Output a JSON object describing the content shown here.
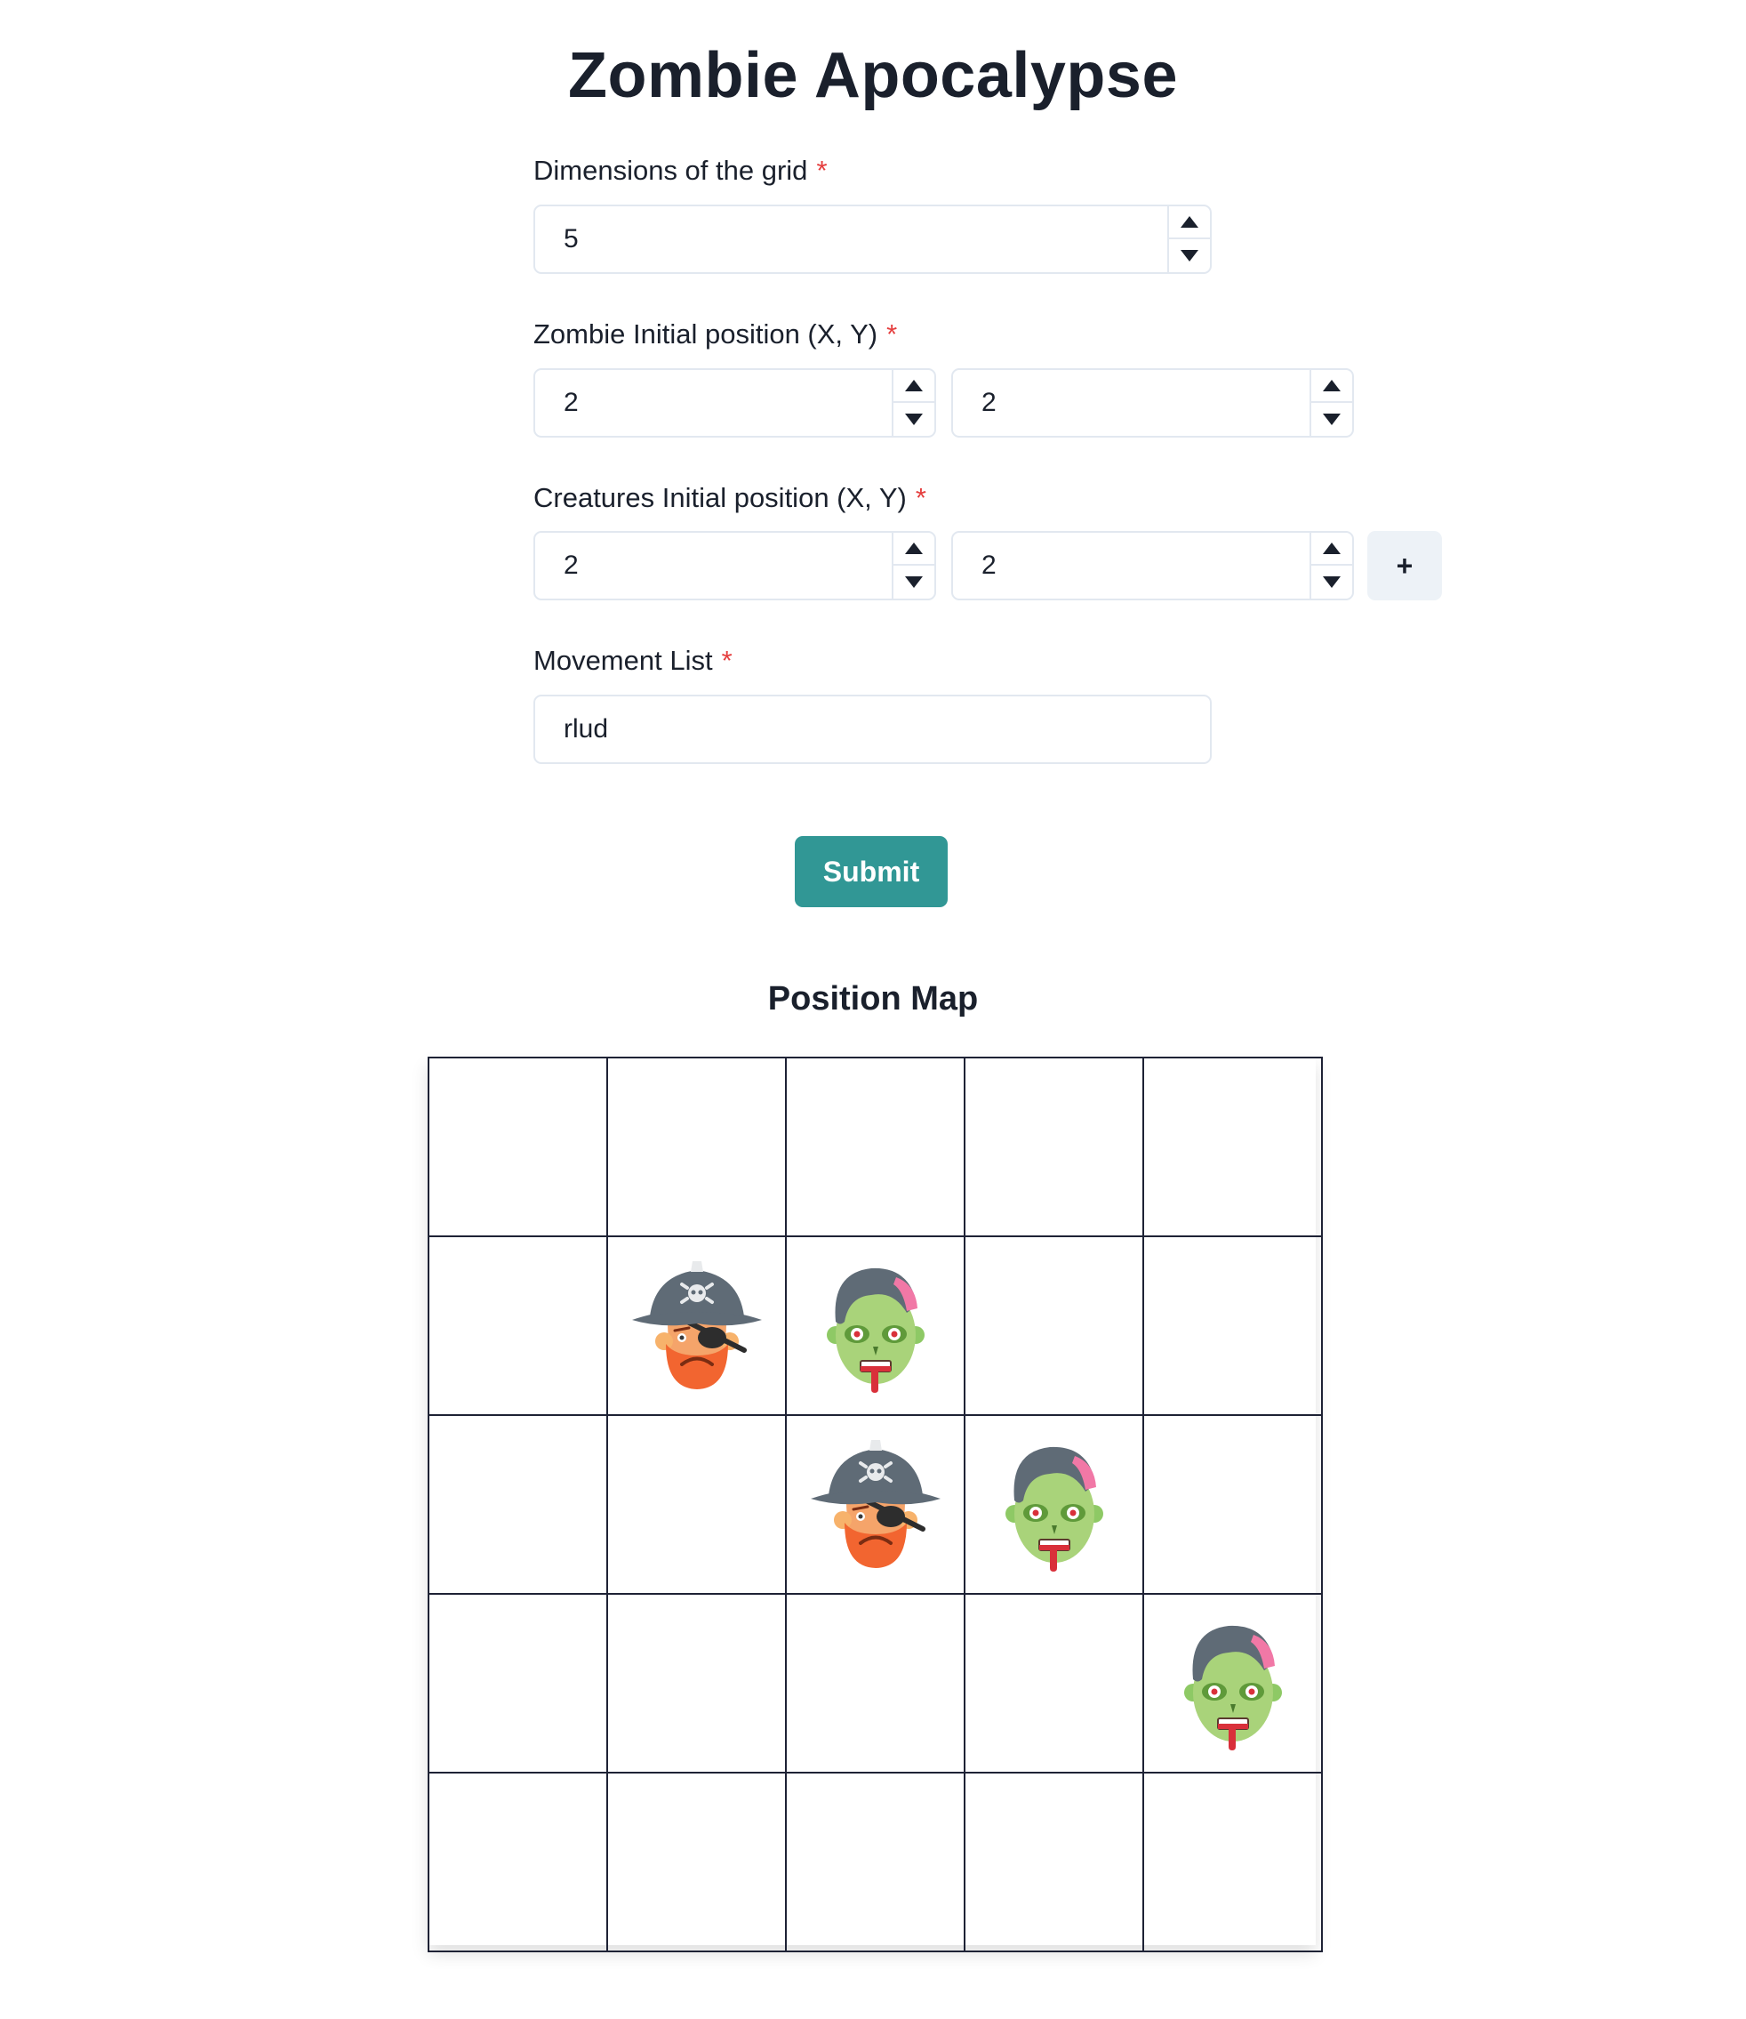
{
  "title": "Zombie Apocalypse",
  "dimensions": {
    "label": "Dimensions of the grid",
    "required_mark": "*",
    "value": "5"
  },
  "zombie_position": {
    "label": "Zombie Initial position (X, Y)",
    "required_mark": "*",
    "x": "2",
    "y": "2"
  },
  "creatures_position": {
    "label": "Creatures Initial position (X, Y)",
    "required_mark": "*",
    "x": "2",
    "y": "2",
    "add_label": "+"
  },
  "movement": {
    "label": "Movement List",
    "required_mark": "*",
    "value": "rlud"
  },
  "submit_label": "Submit",
  "map": {
    "title": "Position Map",
    "size": 5,
    "cells": [
      [
        "",
        "",
        "",
        "",
        ""
      ],
      [
        "",
        "pirate",
        "zombie",
        "",
        ""
      ],
      [
        "",
        "",
        "pirate",
        "zombie",
        ""
      ],
      [
        "",
        "",
        "",
        "",
        "zombie"
      ],
      [
        "",
        "",
        "",
        "",
        ""
      ]
    ]
  },
  "colors": {
    "accent": "#319795",
    "required": "#e53e3e",
    "grid_line": "#1e2235",
    "input_border": "#e2e8f0",
    "secondary_button": "#edf2f7"
  },
  "icons": {
    "pirate": "pirate-icon",
    "zombie": "zombie-icon",
    "stepper_up": "triangle-up-icon",
    "stepper_down": "triangle-down-icon"
  }
}
